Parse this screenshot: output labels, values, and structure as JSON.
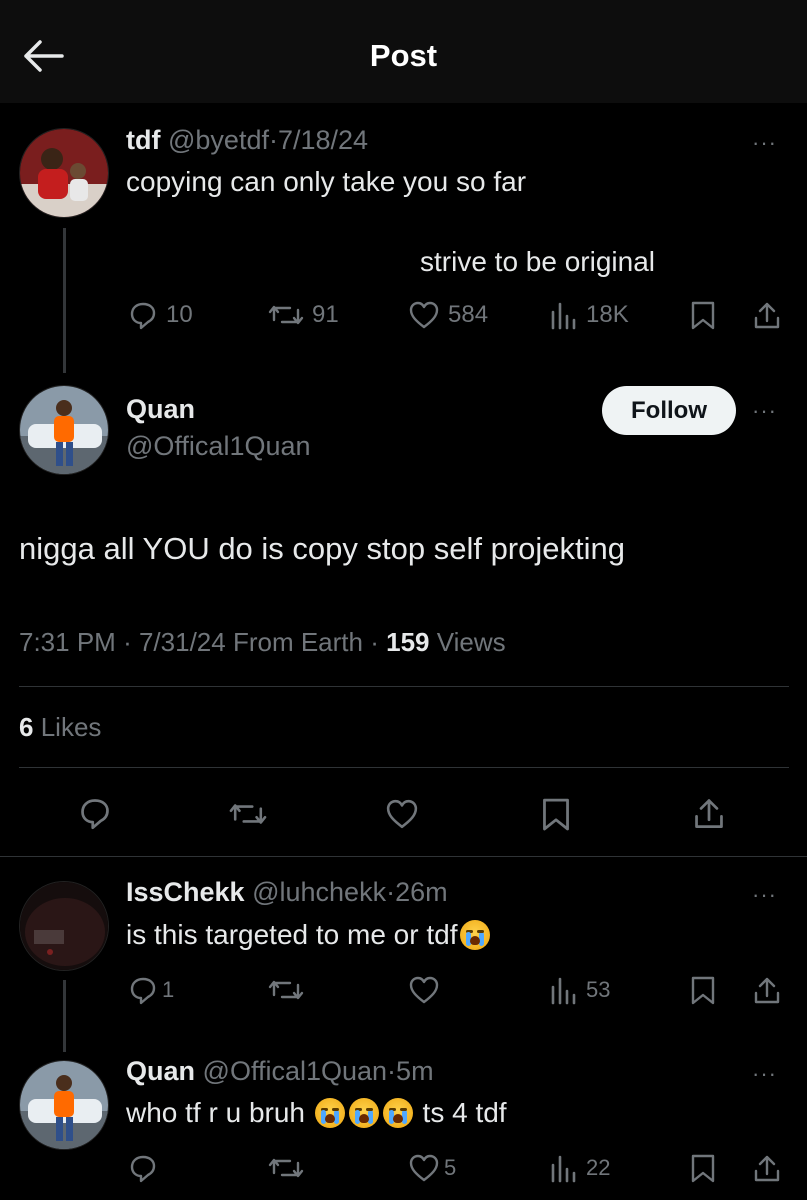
{
  "header": {
    "title": "Post"
  },
  "quoted_post": {
    "name": "tdf",
    "handle": "@byetdf",
    "date": "7/18/24",
    "text_line1": "copying can only take you so far",
    "text_line2": "strive to be original",
    "replies": "10",
    "reposts": "91",
    "likes": "584",
    "views": "18K"
  },
  "main_post": {
    "name": "Quan",
    "handle": "@Offical1Quan",
    "follow_label": "Follow",
    "text": "nigga all YOU do is copy stop self projekting",
    "time": "7:31 PM",
    "date": "7/31/24",
    "source": "From Earth",
    "views_count": "159",
    "views_label": "Views",
    "likes_count": "6",
    "likes_label": "Likes"
  },
  "replies": [
    {
      "name": "IssChekk",
      "handle": "@luhchekk",
      "time": "26m",
      "text": "is this targeted to me or tdf",
      "replies": "1",
      "views": "53"
    },
    {
      "name": "Quan",
      "handle": "@Offical1Quan",
      "time": "5m",
      "text_a": "who tf r u bruh",
      "text_b": "ts 4 tdf",
      "likes": "5",
      "views": "22"
    }
  ],
  "separator": "·",
  "more_glyph": "···",
  "colors": {
    "background": "#000000",
    "muted": "#71767b",
    "text": "#e7e9ea",
    "follow_bg": "#eff3f4"
  },
  "icons": [
    "back-arrow-icon",
    "reply-icon",
    "repost-icon",
    "like-icon",
    "views-icon",
    "bookmark-icon",
    "share-icon",
    "more-icon",
    "crying-emoji-icon"
  ]
}
